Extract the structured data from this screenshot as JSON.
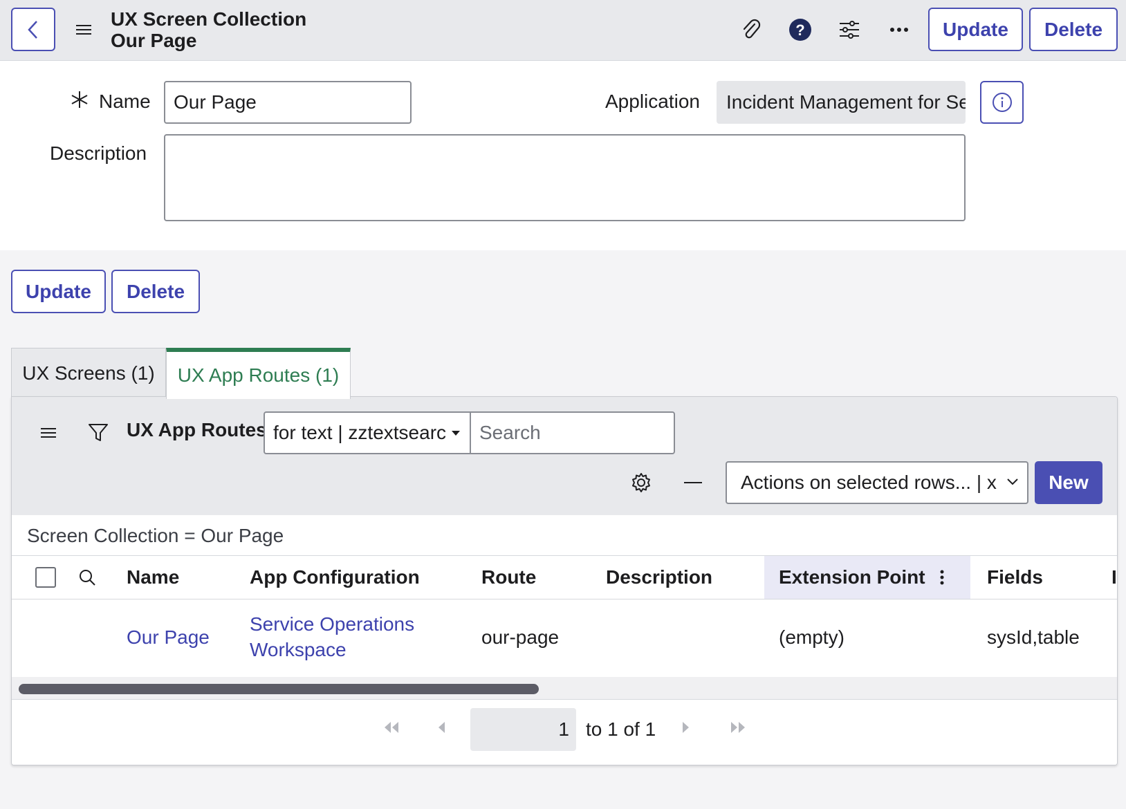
{
  "header": {
    "title_line1": "UX Screen Collection",
    "title_line2": "Our Page",
    "update_label": "Update",
    "delete_label": "Delete"
  },
  "form": {
    "name_label": "Name",
    "name_value": "Our Page",
    "application_label": "Application",
    "application_value": "Incident Management for Se",
    "description_label": "Description",
    "description_value": ""
  },
  "form_actions": {
    "update_label": "Update",
    "delete_label": "Delete"
  },
  "tabs": [
    {
      "label": "UX Screens (1)",
      "active": false
    },
    {
      "label": "UX App Routes (1)",
      "active": true
    }
  ],
  "list": {
    "title": "UX App Routes",
    "search_field_value": "for text | zztextsearc",
    "search_placeholder": "Search",
    "actions_value": "Actions on selected rows... | x",
    "new_label": "New",
    "breadcrumb": "Screen Collection = Our Page",
    "columns": [
      "Name",
      "App Configuration",
      "Route",
      "Description",
      "Extension Point",
      "Fields",
      "I"
    ],
    "rows": [
      {
        "name": "Our Page",
        "app_configuration_line1": "Service Operations",
        "app_configuration_line2": "Workspace",
        "route": "our-page",
        "description": "",
        "extension_point": "(empty)",
        "fields": "sysId,table"
      }
    ]
  },
  "pagination": {
    "current_page": "1",
    "range_text": "to 1 of 1"
  },
  "colors": {
    "accent": "#4a4fb3",
    "active_tab": "#2e7d52",
    "header_bg": "#e8e9ec"
  }
}
